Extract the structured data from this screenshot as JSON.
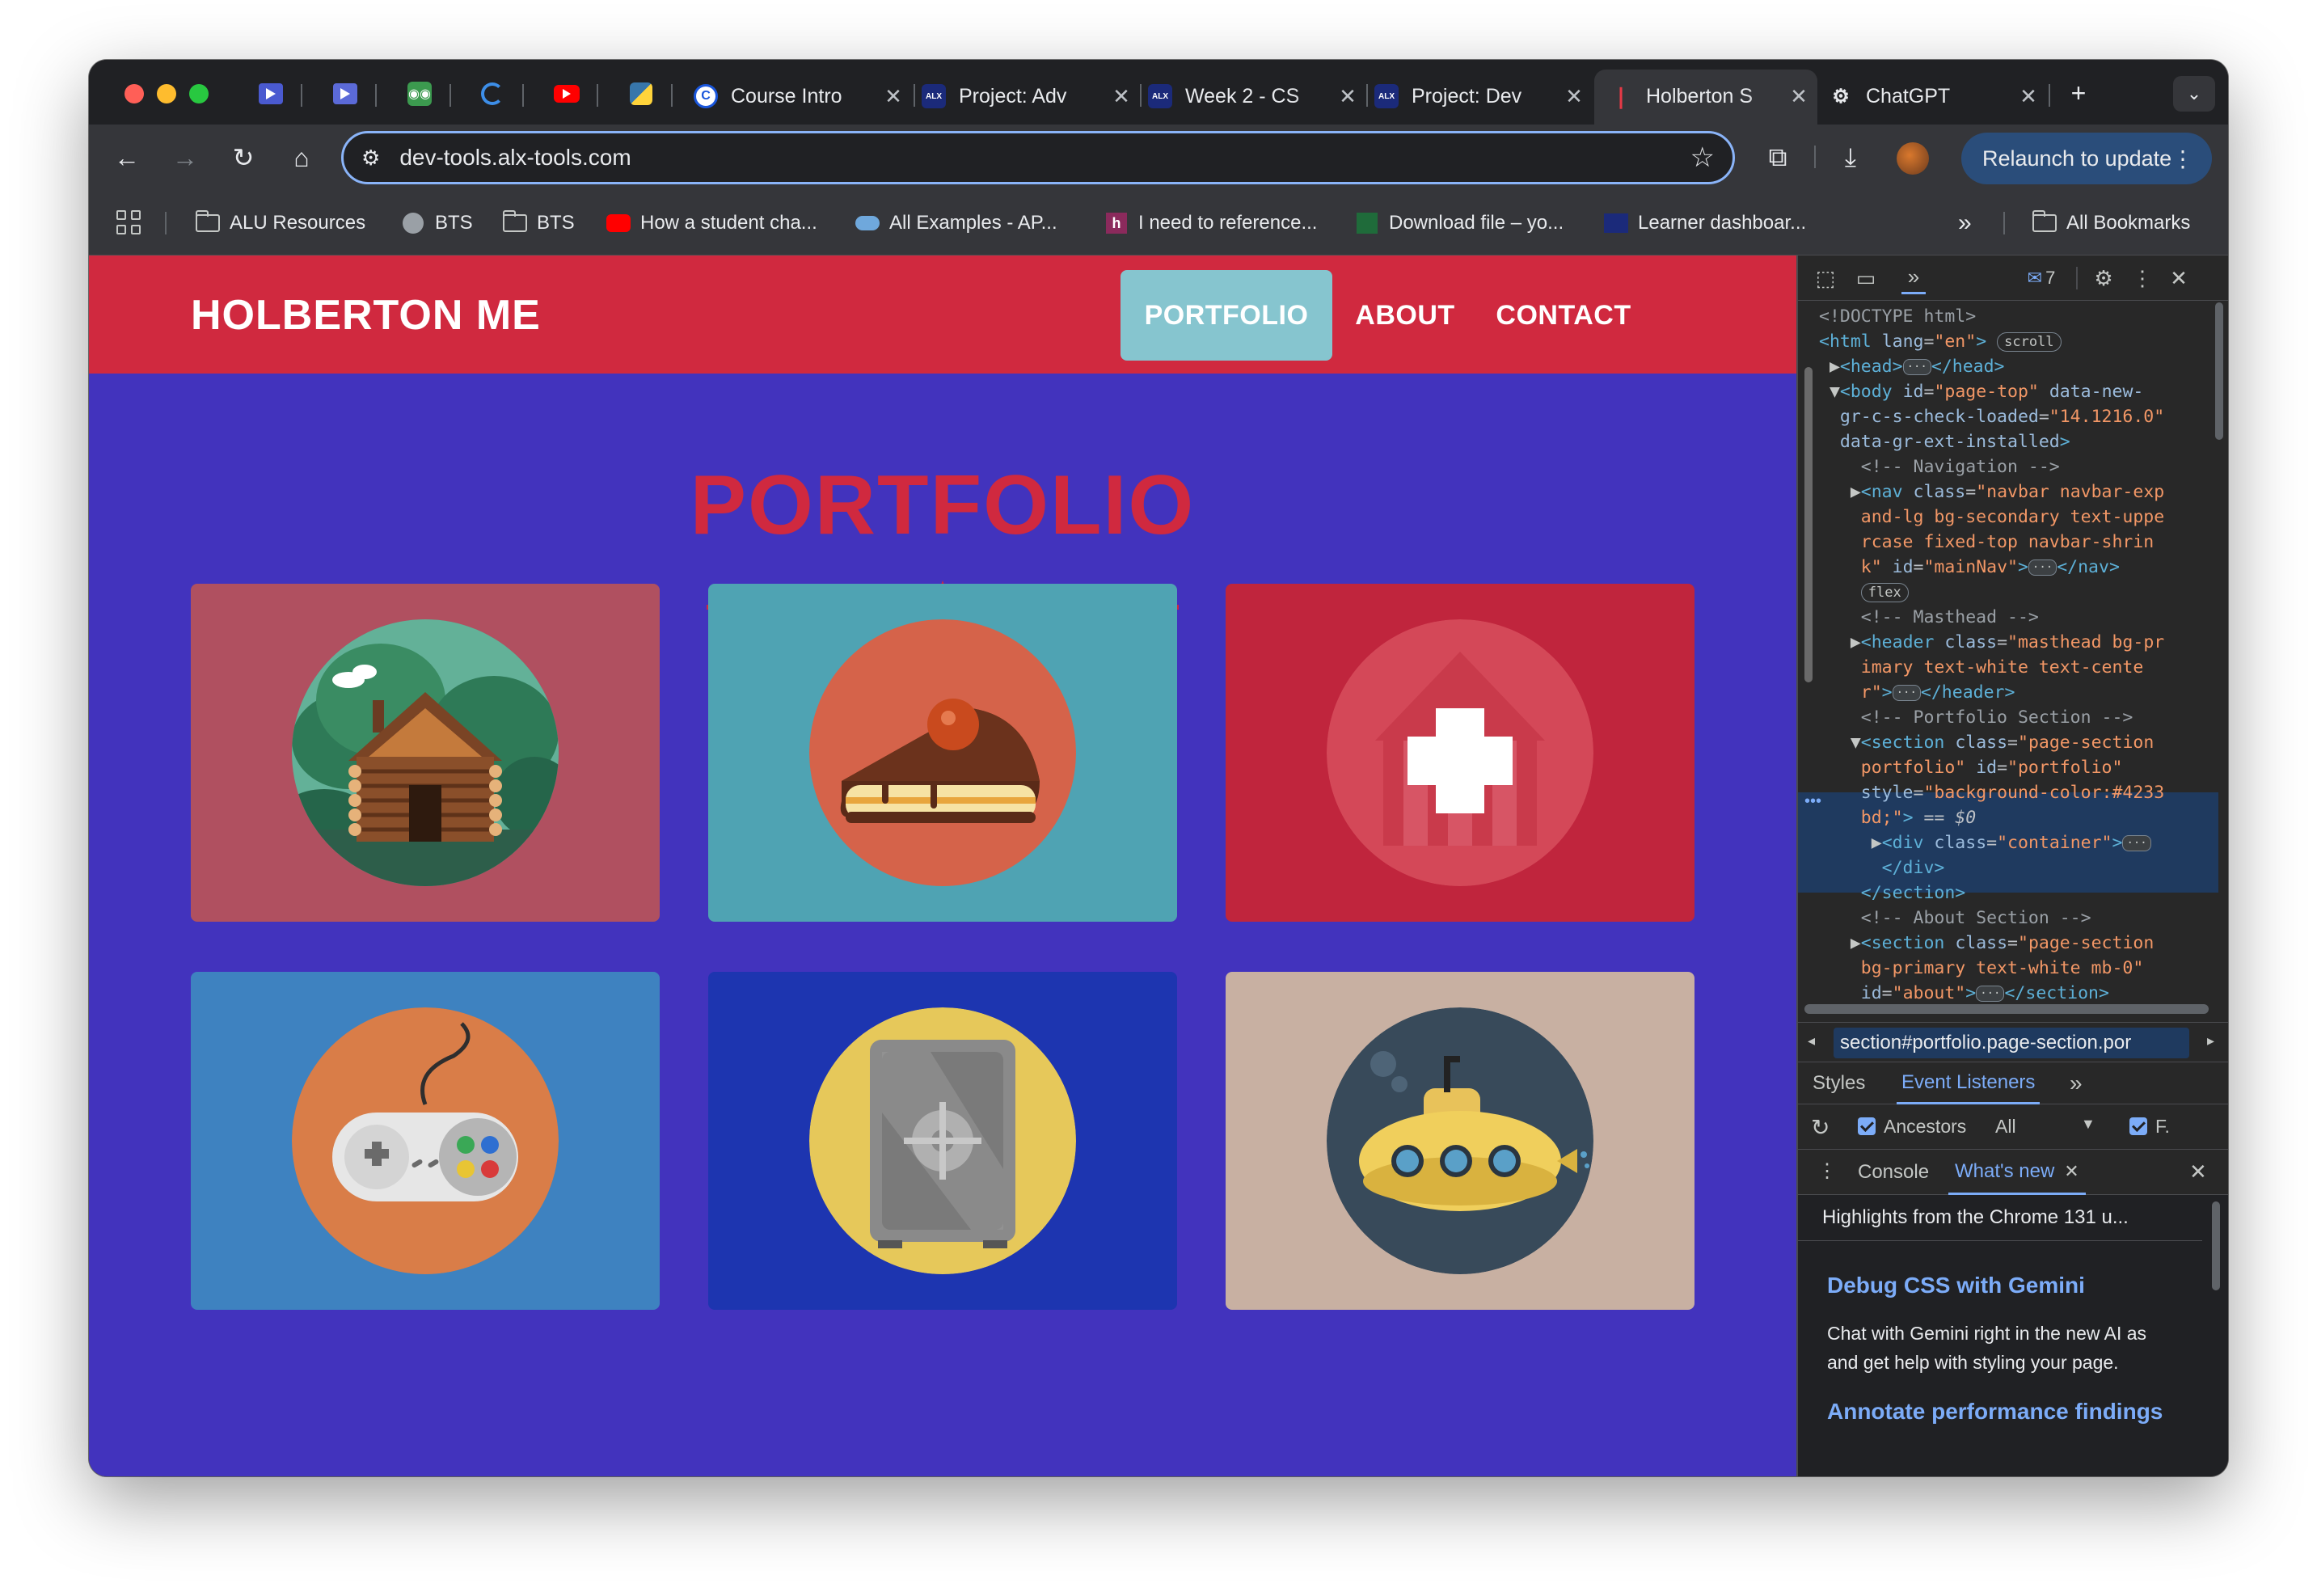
{
  "browser": {
    "tabs": [
      {
        "title": "Course Intro",
        "favicon": "c-logo-icon"
      },
      {
        "title": "Project: Adv",
        "favicon": "alx-icon"
      },
      {
        "title": "Week 2 - CS",
        "favicon": "alx-icon"
      },
      {
        "title": "Project: Dev",
        "favicon": "alx-icon"
      },
      {
        "title": "Holberton S",
        "favicon": "holberton-icon",
        "active": true
      },
      {
        "title": "ChatGPT",
        "favicon": "openai-icon"
      }
    ],
    "address": "dev-tools.alx-tools.com",
    "relaunch_label": "Relaunch to update",
    "bookmarks": [
      {
        "label": "ALU Resources",
        "icon": "folder-icon"
      },
      {
        "label": "BTS",
        "icon": "globe-icon"
      },
      {
        "label": "BTS",
        "icon": "folder-icon"
      },
      {
        "label": "How a student cha...",
        "icon": "youtube-icon"
      },
      {
        "label": "All Examples - AP...",
        "icon": "cloud-icon"
      },
      {
        "label": "I need to reference...",
        "icon": "hypothesis-icon"
      },
      {
        "label": "Download file – yo...",
        "icon": "download-site-icon"
      },
      {
        "label": "Learner dashboar...",
        "icon": "alx-icon"
      }
    ],
    "all_bookmarks_label": "All Bookmarks"
  },
  "site": {
    "brand": "HOLBERTON ME",
    "nav": [
      "PORTFOLIO",
      "ABOUT",
      "CONTACT"
    ],
    "section_title": "PORTFOLIO",
    "colors": {
      "navbar": "#d0293f",
      "section_bg": "#4233bd",
      "active_nav": "#86c5cf"
    },
    "portfolio_items": [
      {
        "name": "cabin",
        "bg": "#b05060"
      },
      {
        "name": "cake",
        "bg": "#4fa3b3"
      },
      {
        "name": "circus",
        "bg": "#c0253d"
      },
      {
        "name": "game",
        "bg": "#3e82c0"
      },
      {
        "name": "safe",
        "bg": "#1d35b0"
      },
      {
        "name": "submarine",
        "bg": "#c8b0a2"
      }
    ]
  },
  "devtools": {
    "issues_count": "7",
    "breadcrumb": "section#portfolio.page-section.por",
    "subtabs": [
      "Styles",
      "Event Listeners"
    ],
    "filter": {
      "ancestors_label": "Ancestors",
      "scope": "All",
      "framework_label": "F."
    },
    "drawer_tabs": [
      "Console",
      "What's new"
    ],
    "whats_new": {
      "highlight": "Highlights from the Chrome 131 u...",
      "h1": "Debug CSS with Gemini",
      "p1a": "Chat with Gemini right in the new AI as",
      "p1b": "and get help with styling your page.",
      "h2": "Annotate performance findings"
    }
  }
}
